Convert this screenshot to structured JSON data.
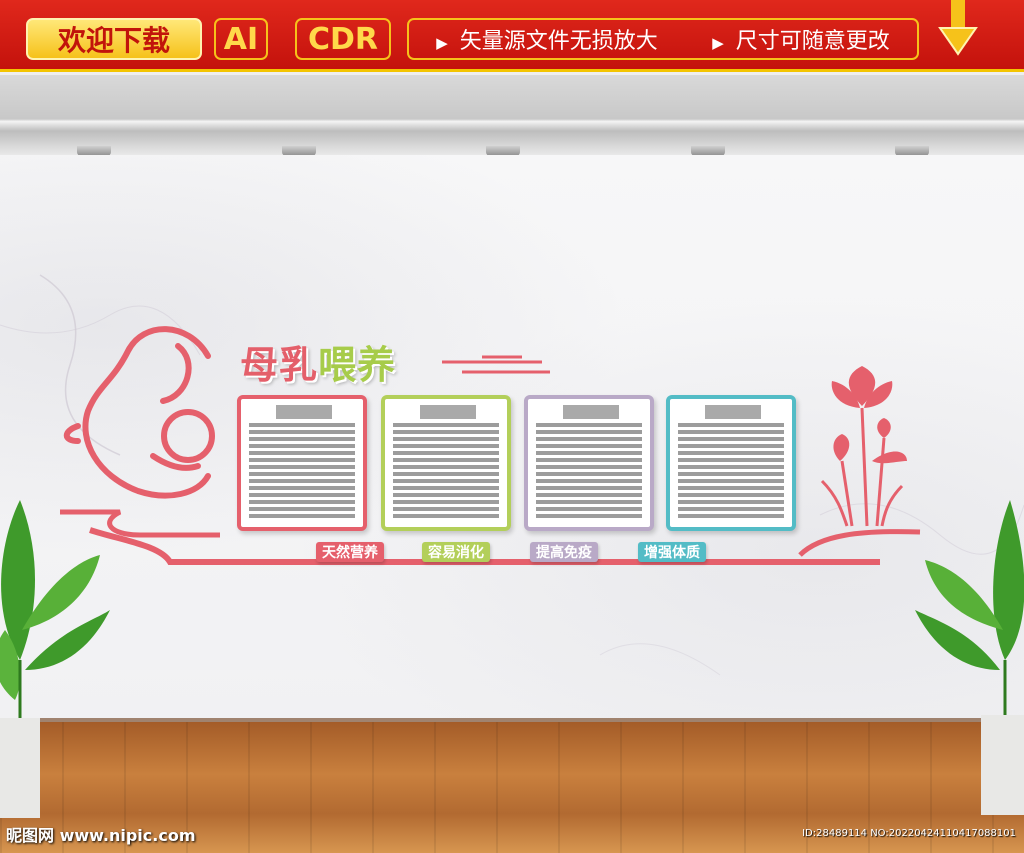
{
  "banner": {
    "welcome": "欢迎下载",
    "format_ai": "AI",
    "format_cdr": "CDR",
    "feature_1": "矢量源文件无损放大",
    "feature_2": "尺寸可随意更改"
  },
  "display": {
    "title_part1": "母乳",
    "title_part2": "喂养",
    "panels": [
      {
        "border_color": "#e5606c"
      },
      {
        "border_color": "#b3cf5a"
      },
      {
        "border_color": "#b9a9c7"
      },
      {
        "border_color": "#53bcc6"
      }
    ],
    "tags": [
      {
        "label": "天然营养",
        "color": "#e5606c"
      },
      {
        "label": "容易消化",
        "color": "#b3cf5a"
      },
      {
        "label": "提高免疫",
        "color": "#b9a9c7"
      },
      {
        "label": "增强体质",
        "color": "#53bcc6"
      }
    ]
  },
  "watermark": {
    "site": "昵图网 www.nipic.com",
    "id": "ID:28489114 NO:20220424110417088101"
  },
  "colors": {
    "banner_red": "#d01c12",
    "gold": "#f6c21a",
    "pink": "#e5606c"
  }
}
